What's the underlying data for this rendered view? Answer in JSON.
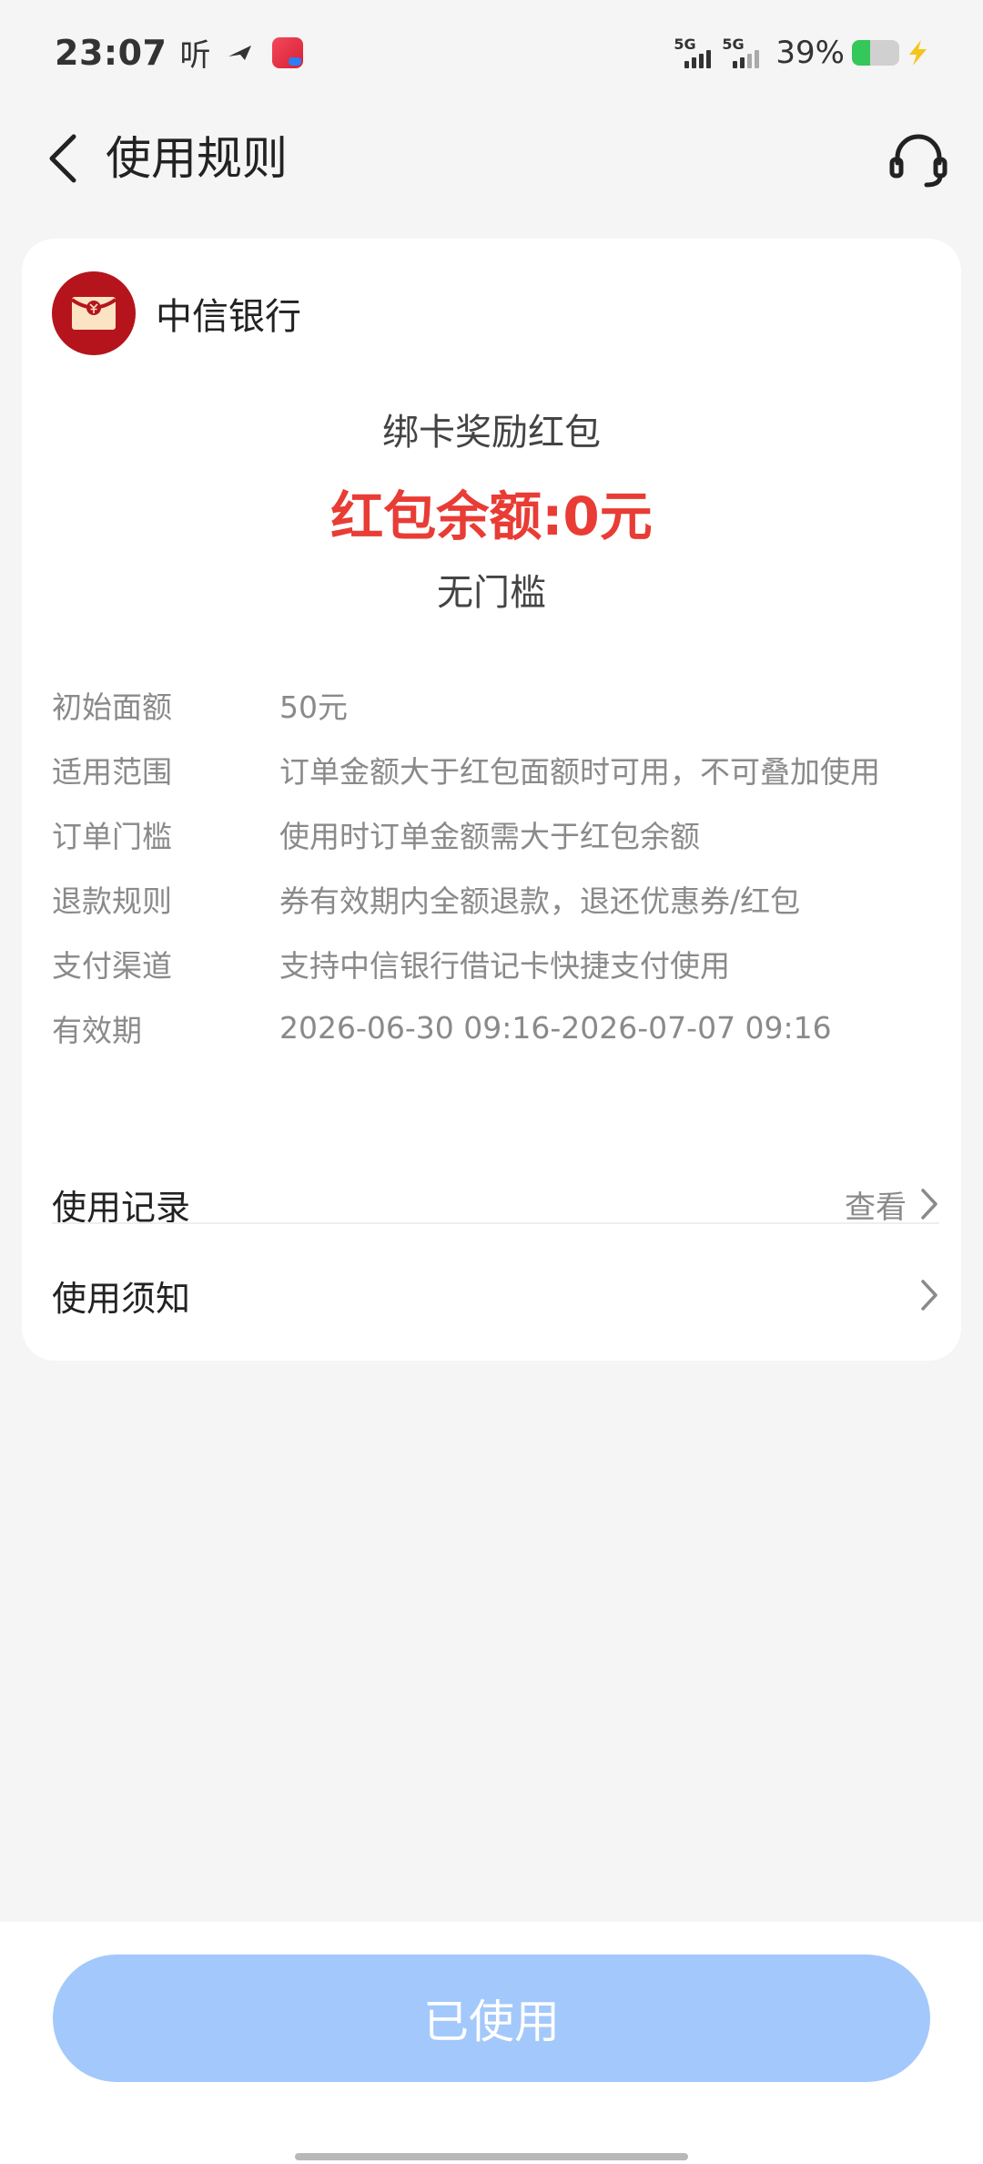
{
  "status_bar": {
    "time": "23:07",
    "ting": "听",
    "net1": "5G",
    "net2": "5G",
    "battery_pct": "39%",
    "battery_level": 0.39
  },
  "header": {
    "title": "使用规则"
  },
  "card": {
    "bank_name": "中信银行",
    "reward_name": "绑卡奖励红包",
    "balance": "红包余额:0元",
    "threshold": "无门槛",
    "rules": [
      {
        "label": "初始面额",
        "value": "50元"
      },
      {
        "label": "适用范围",
        "value": "订单金额大于红包面额时可用，不可叠加使用"
      },
      {
        "label": "订单门槛",
        "value": "使用时订单金额需大于红包余额"
      },
      {
        "label": "退款规则",
        "value": "券有效期内全额退款，退还优惠券/红包"
      },
      {
        "label": "支付渠道",
        "value": "支持中信银行借记卡快捷支付使用"
      },
      {
        "label": "有效期",
        "value": "2026-06-30 09:16-2026-07-07 09:16"
      }
    ],
    "records": {
      "title": "使用记录",
      "action": "查看"
    },
    "notice": {
      "title": "使用须知"
    }
  },
  "bottom": {
    "button_label": "已使用"
  },
  "colors": {
    "accent_red": "#e83c35",
    "button_blue": "#a3c8fb",
    "battery_green": "#34c759"
  }
}
